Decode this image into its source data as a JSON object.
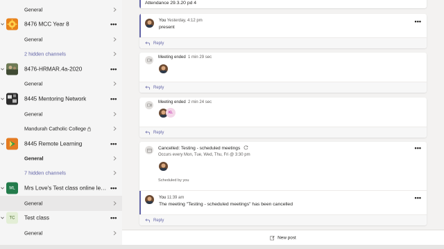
{
  "sidebar": {
    "rows": [
      {
        "kind": "channel",
        "label": "General"
      },
      {
        "kind": "team",
        "name": "8476 MCC Year 8",
        "avatar": "gear-sun-logo"
      },
      {
        "kind": "channel",
        "label": "General"
      },
      {
        "kind": "channel-link",
        "label": "2 hidden channels"
      },
      {
        "kind": "team",
        "name": "8476-HRMAR.4a-2020",
        "avatar": "photo"
      },
      {
        "kind": "channel",
        "label": "General"
      },
      {
        "kind": "team",
        "name": "8445 Mentoring Network",
        "avatar": "photo"
      },
      {
        "kind": "channel",
        "label": "General"
      },
      {
        "kind": "channel",
        "label": "Mandurah Catholic College"
      },
      {
        "kind": "team",
        "name": "8445 Remote Learning",
        "avatar": "play-logo"
      },
      {
        "kind": "channel-bold",
        "label": "General"
      },
      {
        "kind": "channel-link",
        "label": "7 hidden channels"
      },
      {
        "kind": "team",
        "name": "Mrs Love's Test class online lea...",
        "avatar_text": "ML"
      },
      {
        "kind": "channel-selected",
        "label": "General"
      },
      {
        "kind": "team",
        "name": "Test class",
        "avatar_text": "TC"
      },
      {
        "kind": "channel",
        "label": "General"
      }
    ]
  },
  "feed": {
    "attendance_text": "Attendance 29.3.20 pd 4",
    "msg1": {
      "author": "You",
      "time": "Yesterday, 4:12 pm",
      "text": "present"
    },
    "reply_label": "Reply",
    "meeting1": {
      "title": "Meeting ended",
      "duration": "1 min 29 sec"
    },
    "meeting2": {
      "title": "Meeting ended",
      "duration": "2 min 24 sec",
      "participant_initials": "KL"
    },
    "scheduled": {
      "title": "Cancelled: Testing - scheduled meetings",
      "recurrence": "Occurs every Mon, Tue, Wed, Thu, Fri @ 3:30 pm",
      "scheduled_by": "Scheduled by you",
      "reply_author": "You",
      "reply_time": "11:39 am",
      "reply_text": "The meeting \"Testing - scheduled meetings\" has been cancelled"
    },
    "more_label": "•••"
  },
  "new_post_label": "New post",
  "colors": {
    "accent": "#6264a7",
    "sidebar_bg": "#f5f5f5",
    "main_bg": "#f3f2f1"
  }
}
